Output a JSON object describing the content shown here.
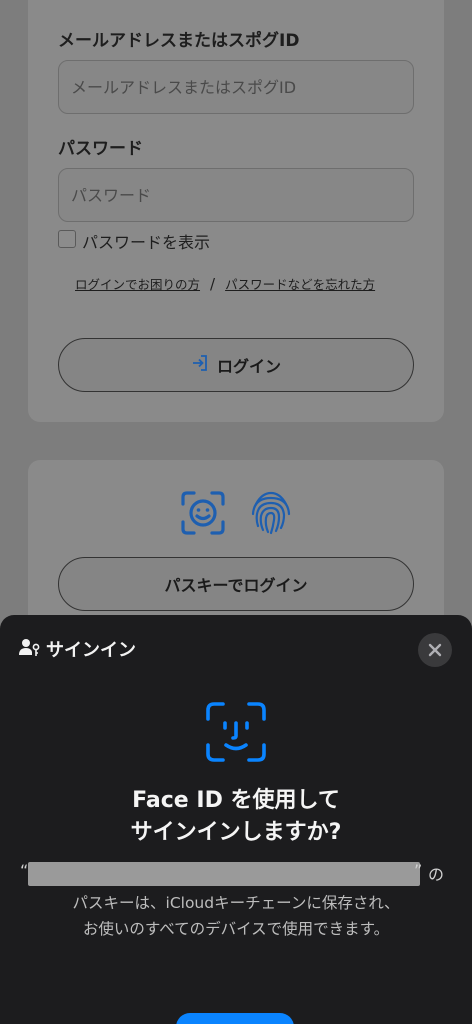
{
  "login_form": {
    "email_label": "メールアドレスまたはスポグID",
    "email_placeholder": "メールアドレスまたはスポグID",
    "password_label": "パスワード",
    "password_placeholder": "パスワード",
    "show_password_label": "パスワードを表示",
    "trouble_link": "ログインでお困りの方",
    "separator": "/",
    "forgot_link": "パスワードなどを忘れた方",
    "login_button": "ログイン"
  },
  "passkey_card": {
    "icons": [
      "face-id-icon",
      "fingerprint-icon"
    ],
    "button_label": "パスキーでログイン"
  },
  "sheet": {
    "title": "サインイン",
    "heading_line1": "Face ID を使用して",
    "heading_line2": "サインインしますか?",
    "quote_open": "“",
    "quote_close": "”",
    "suffix": "の",
    "desc_line1": "パスキーは、iCloudキーチェーンに保存され、",
    "desc_line2": "お使いのすべてのデバイスで使用できます。"
  },
  "colors": {
    "accent_blue": "#0a84ff",
    "icon_blue": "#1e5fb0",
    "sheet_bg": "#1c1c1e"
  }
}
